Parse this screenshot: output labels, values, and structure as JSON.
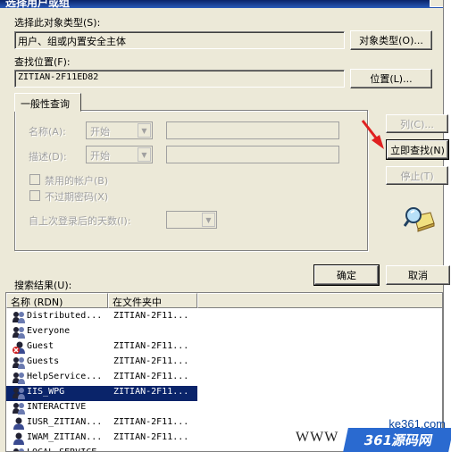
{
  "window": {
    "title": "选择用户或组"
  },
  "object_type": {
    "label": "选择此对象类型(S):",
    "value": "用户、组或内置安全主体",
    "button": "对象类型(O)..."
  },
  "location": {
    "label": "查找位置(F):",
    "value": "ZITIAN-2F11ED82",
    "button": "位置(L)..."
  },
  "general_query": {
    "tab": "一般性查询",
    "name_label": "名称(A):",
    "name_mode": "开始",
    "desc_label": "描述(D):",
    "desc_mode": "开始",
    "disabled_accounts": "禁用的帐户(B)",
    "non_expiring": "不过期密码(X)",
    "days_label": "自上次登录后的天数(I):"
  },
  "actions": {
    "columns": "列(C)...",
    "find_now": "立即查找(N)",
    "stop": "停止(T)",
    "ok": "确定",
    "cancel": "取消"
  },
  "results": {
    "label": "搜索结果(U):",
    "columns": [
      "名称 (RDN)",
      "在文件夹中"
    ],
    "rows": [
      {
        "name": "Distributed...",
        "folder": "ZITIAN-2F11...",
        "icon": "group-icon"
      },
      {
        "name": "Everyone",
        "folder": "",
        "icon": "group-icon"
      },
      {
        "name": "Guest",
        "folder": "ZITIAN-2F11...",
        "icon": "disabled-user-icon"
      },
      {
        "name": "Guests",
        "folder": "ZITIAN-2F11...",
        "icon": "group-icon"
      },
      {
        "name": "HelpService...",
        "folder": "ZITIAN-2F11...",
        "icon": "group-icon"
      },
      {
        "name": "IIS_WPG",
        "folder": "ZITIAN-2F11...",
        "icon": "group-icon",
        "selected": true
      },
      {
        "name": "INTERACTIVE",
        "folder": "",
        "icon": "group-icon"
      },
      {
        "name": "IUSR_ZITIAN...",
        "folder": "ZITIAN-2F11...",
        "icon": "user-icon"
      },
      {
        "name": "IWAM_ZITIAN...",
        "folder": "ZITIAN-2F11...",
        "icon": "user-icon"
      },
      {
        "name": "LOCAL SERVICE",
        "folder": "",
        "icon": "group-icon"
      }
    ]
  },
  "watermark": {
    "site": "ke361.com",
    "www": "WWW",
    "brand": "361源码网"
  }
}
